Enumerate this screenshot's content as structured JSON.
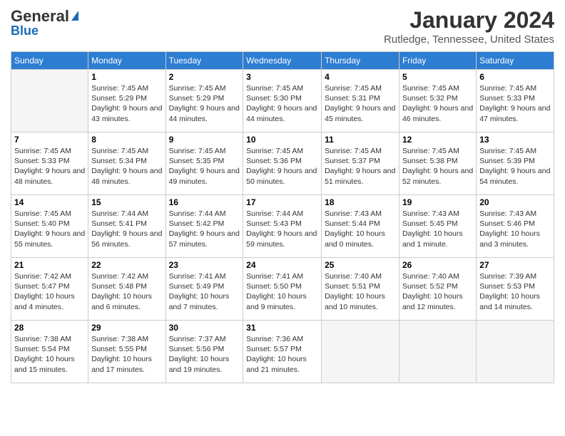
{
  "header": {
    "logo_general": "General",
    "logo_blue": "Blue",
    "month_title": "January 2024",
    "location": "Rutledge, Tennessee, United States"
  },
  "days_of_week": [
    "Sunday",
    "Monday",
    "Tuesday",
    "Wednesday",
    "Thursday",
    "Friday",
    "Saturday"
  ],
  "weeks": [
    [
      {
        "day": "",
        "sunrise": "",
        "sunset": "",
        "daylight": "",
        "empty": true
      },
      {
        "day": "1",
        "sunrise": "Sunrise: 7:45 AM",
        "sunset": "Sunset: 5:29 PM",
        "daylight": "Daylight: 9 hours and 43 minutes.",
        "empty": false
      },
      {
        "day": "2",
        "sunrise": "Sunrise: 7:45 AM",
        "sunset": "Sunset: 5:29 PM",
        "daylight": "Daylight: 9 hours and 44 minutes.",
        "empty": false
      },
      {
        "day": "3",
        "sunrise": "Sunrise: 7:45 AM",
        "sunset": "Sunset: 5:30 PM",
        "daylight": "Daylight: 9 hours and 44 minutes.",
        "empty": false
      },
      {
        "day": "4",
        "sunrise": "Sunrise: 7:45 AM",
        "sunset": "Sunset: 5:31 PM",
        "daylight": "Daylight: 9 hours and 45 minutes.",
        "empty": false
      },
      {
        "day": "5",
        "sunrise": "Sunrise: 7:45 AM",
        "sunset": "Sunset: 5:32 PM",
        "daylight": "Daylight: 9 hours and 46 minutes.",
        "empty": false
      },
      {
        "day": "6",
        "sunrise": "Sunrise: 7:45 AM",
        "sunset": "Sunset: 5:33 PM",
        "daylight": "Daylight: 9 hours and 47 minutes.",
        "empty": false
      }
    ],
    [
      {
        "day": "7",
        "sunrise": "Sunrise: 7:45 AM",
        "sunset": "Sunset: 5:33 PM",
        "daylight": "Daylight: 9 hours and 48 minutes.",
        "empty": false
      },
      {
        "day": "8",
        "sunrise": "Sunrise: 7:45 AM",
        "sunset": "Sunset: 5:34 PM",
        "daylight": "Daylight: 9 hours and 48 minutes.",
        "empty": false
      },
      {
        "day": "9",
        "sunrise": "Sunrise: 7:45 AM",
        "sunset": "Sunset: 5:35 PM",
        "daylight": "Daylight: 9 hours and 49 minutes.",
        "empty": false
      },
      {
        "day": "10",
        "sunrise": "Sunrise: 7:45 AM",
        "sunset": "Sunset: 5:36 PM",
        "daylight": "Daylight: 9 hours and 50 minutes.",
        "empty": false
      },
      {
        "day": "11",
        "sunrise": "Sunrise: 7:45 AM",
        "sunset": "Sunset: 5:37 PM",
        "daylight": "Daylight: 9 hours and 51 minutes.",
        "empty": false
      },
      {
        "day": "12",
        "sunrise": "Sunrise: 7:45 AM",
        "sunset": "Sunset: 5:38 PM",
        "daylight": "Daylight: 9 hours and 52 minutes.",
        "empty": false
      },
      {
        "day": "13",
        "sunrise": "Sunrise: 7:45 AM",
        "sunset": "Sunset: 5:39 PM",
        "daylight": "Daylight: 9 hours and 54 minutes.",
        "empty": false
      }
    ],
    [
      {
        "day": "14",
        "sunrise": "Sunrise: 7:45 AM",
        "sunset": "Sunset: 5:40 PM",
        "daylight": "Daylight: 9 hours and 55 minutes.",
        "empty": false
      },
      {
        "day": "15",
        "sunrise": "Sunrise: 7:44 AM",
        "sunset": "Sunset: 5:41 PM",
        "daylight": "Daylight: 9 hours and 56 minutes.",
        "empty": false
      },
      {
        "day": "16",
        "sunrise": "Sunrise: 7:44 AM",
        "sunset": "Sunset: 5:42 PM",
        "daylight": "Daylight: 9 hours and 57 minutes.",
        "empty": false
      },
      {
        "day": "17",
        "sunrise": "Sunrise: 7:44 AM",
        "sunset": "Sunset: 5:43 PM",
        "daylight": "Daylight: 9 hours and 59 minutes.",
        "empty": false
      },
      {
        "day": "18",
        "sunrise": "Sunrise: 7:43 AM",
        "sunset": "Sunset: 5:44 PM",
        "daylight": "Daylight: 10 hours and 0 minutes.",
        "empty": false
      },
      {
        "day": "19",
        "sunrise": "Sunrise: 7:43 AM",
        "sunset": "Sunset: 5:45 PM",
        "daylight": "Daylight: 10 hours and 1 minute.",
        "empty": false
      },
      {
        "day": "20",
        "sunrise": "Sunrise: 7:43 AM",
        "sunset": "Sunset: 5:46 PM",
        "daylight": "Daylight: 10 hours and 3 minutes.",
        "empty": false
      }
    ],
    [
      {
        "day": "21",
        "sunrise": "Sunrise: 7:42 AM",
        "sunset": "Sunset: 5:47 PM",
        "daylight": "Daylight: 10 hours and 4 minutes.",
        "empty": false
      },
      {
        "day": "22",
        "sunrise": "Sunrise: 7:42 AM",
        "sunset": "Sunset: 5:48 PM",
        "daylight": "Daylight: 10 hours and 6 minutes.",
        "empty": false
      },
      {
        "day": "23",
        "sunrise": "Sunrise: 7:41 AM",
        "sunset": "Sunset: 5:49 PM",
        "daylight": "Daylight: 10 hours and 7 minutes.",
        "empty": false
      },
      {
        "day": "24",
        "sunrise": "Sunrise: 7:41 AM",
        "sunset": "Sunset: 5:50 PM",
        "daylight": "Daylight: 10 hours and 9 minutes.",
        "empty": false
      },
      {
        "day": "25",
        "sunrise": "Sunrise: 7:40 AM",
        "sunset": "Sunset: 5:51 PM",
        "daylight": "Daylight: 10 hours and 10 minutes.",
        "empty": false
      },
      {
        "day": "26",
        "sunrise": "Sunrise: 7:40 AM",
        "sunset": "Sunset: 5:52 PM",
        "daylight": "Daylight: 10 hours and 12 minutes.",
        "empty": false
      },
      {
        "day": "27",
        "sunrise": "Sunrise: 7:39 AM",
        "sunset": "Sunset: 5:53 PM",
        "daylight": "Daylight: 10 hours and 14 minutes.",
        "empty": false
      }
    ],
    [
      {
        "day": "28",
        "sunrise": "Sunrise: 7:38 AM",
        "sunset": "Sunset: 5:54 PM",
        "daylight": "Daylight: 10 hours and 15 minutes.",
        "empty": false
      },
      {
        "day": "29",
        "sunrise": "Sunrise: 7:38 AM",
        "sunset": "Sunset: 5:55 PM",
        "daylight": "Daylight: 10 hours and 17 minutes.",
        "empty": false
      },
      {
        "day": "30",
        "sunrise": "Sunrise: 7:37 AM",
        "sunset": "Sunset: 5:56 PM",
        "daylight": "Daylight: 10 hours and 19 minutes.",
        "empty": false
      },
      {
        "day": "31",
        "sunrise": "Sunrise: 7:36 AM",
        "sunset": "Sunset: 5:57 PM",
        "daylight": "Daylight: 10 hours and 21 minutes.",
        "empty": false
      },
      {
        "day": "",
        "sunrise": "",
        "sunset": "",
        "daylight": "",
        "empty": true
      },
      {
        "day": "",
        "sunrise": "",
        "sunset": "",
        "daylight": "",
        "empty": true
      },
      {
        "day": "",
        "sunrise": "",
        "sunset": "",
        "daylight": "",
        "empty": true
      }
    ]
  ]
}
